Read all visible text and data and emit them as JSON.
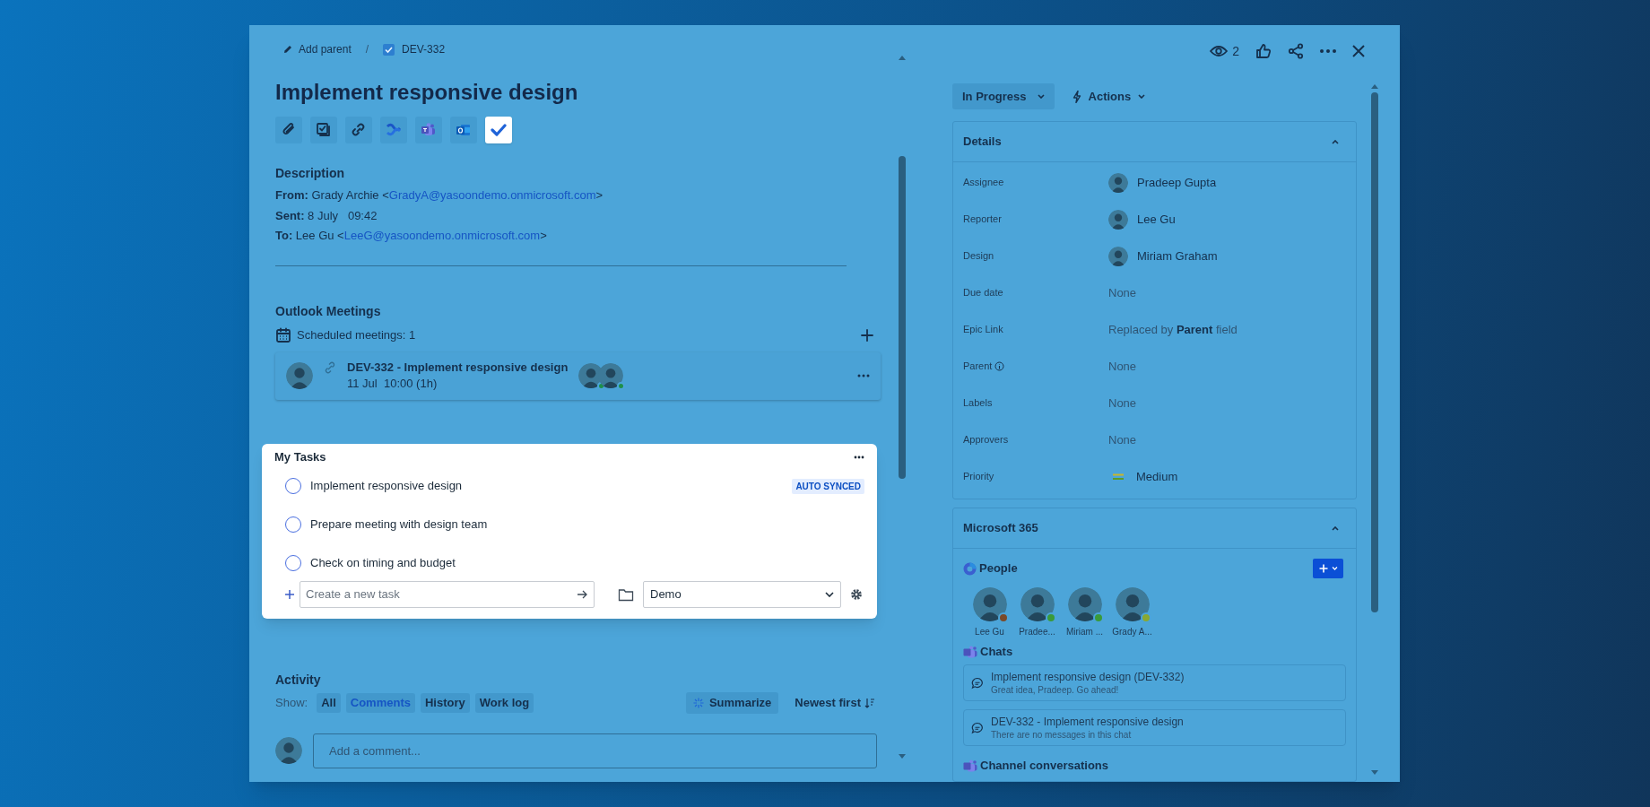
{
  "breadcrumb": {
    "parent": "Add parent",
    "separator": "/",
    "issue": "DEV-332"
  },
  "title": "Implement responsive design",
  "toolbar": [
    {
      "kind": "attach",
      "selected": false
    },
    {
      "kind": "checklist",
      "selected": false
    },
    {
      "kind": "link",
      "selected": false
    },
    {
      "kind": "confluence",
      "selected": false
    },
    {
      "kind": "teams",
      "selected": false
    },
    {
      "kind": "outlook",
      "selected": false
    },
    {
      "kind": "todo",
      "selected": true
    }
  ],
  "description": {
    "heading": "Description",
    "lines": [
      {
        "label": "From:",
        "text": "Grady Archie <",
        "link": "GradyA@yasoondemo.onmicrosoft.com",
        "after": ">"
      },
      {
        "label": "Sent:",
        "text": "8 July   09:42"
      },
      {
        "label": "To:",
        "text": "Lee Gu <",
        "link": "LeeG@yasoondemo.onmicrosoft.com",
        "after": ">"
      }
    ]
  },
  "meetings": {
    "heading": "Outlook Meetings",
    "count": "Scheduled meetings: 1",
    "items": [
      {
        "title": "DEV-332 - Implement responsive design",
        "time": "11 Jul  10:00 (1h)"
      }
    ]
  },
  "tasks": {
    "heading": "My Tasks",
    "items": [
      {
        "text": "Implement responsive design",
        "checked": false,
        "badge": "AUTO SYNCED"
      },
      {
        "text": "Prepare meeting with design team",
        "checked": false
      },
      {
        "text": "Check on timing and budget",
        "checked": false
      }
    ],
    "placeholder": "Create a new task",
    "list": "Demo"
  },
  "activity": {
    "heading": "Activity",
    "show": "Show:",
    "filters": [
      {
        "label": "All",
        "selected": false
      },
      {
        "label": "Comments",
        "selected": true
      },
      {
        "label": "History",
        "selected": false
      },
      {
        "label": "Work log",
        "selected": false
      }
    ],
    "summarize": "Summarize",
    "sort": "Newest first",
    "comment_placeholder": "Add a comment..."
  },
  "header": {
    "watchers": "2"
  },
  "status": "In Progress",
  "actions": "Actions",
  "details": {
    "title": "Details",
    "expanded": true,
    "rows": [
      {
        "label": "Assignee",
        "value": "Pradeep Gupta",
        "kind": "person",
        "info": false
      },
      {
        "label": "Reporter",
        "value": "Lee Gu",
        "kind": "person",
        "info": false
      },
      {
        "label": "Design",
        "value": "Miriam Graham",
        "kind": "person",
        "info": false
      },
      {
        "label": "Due date",
        "value": "None",
        "kind": "empty",
        "info": false
      },
      {
        "label": "Epic Link",
        "value": "Replaced by **Parent** field",
        "kind": "empty",
        "info": false
      },
      {
        "label": "Parent",
        "value": "None",
        "kind": "empty",
        "info": true
      },
      {
        "label": "Labels",
        "value": "None",
        "kind": "empty",
        "info": false
      },
      {
        "label": "Approvers",
        "value": "None",
        "kind": "empty",
        "info": false
      },
      {
        "label": "Priority",
        "value": "Medium",
        "kind": "priority",
        "info": false
      }
    ]
  },
  "m365": {
    "title": "Microsoft 365",
    "expanded": true,
    "people_heading": "People",
    "people": [
      {
        "name": "Lee Gu",
        "color": "#7a4a2a"
      },
      {
        "name": "Pradee...",
        "color": "#3a9a3a"
      },
      {
        "name": "Miriam ...",
        "color": "#3a9a3a"
      },
      {
        "name": "Grady A...",
        "color": "#8aa830"
      }
    ],
    "chats_heading": "Chats",
    "chats": [
      {
        "title": "Implement responsive design (DEV-332)",
        "subtitle": "Great idea, Pradeep. Go ahead!"
      },
      {
        "title": "DEV-332 - Implement responsive design",
        "subtitle": "There are no messages in this chat"
      }
    ],
    "channels_heading": "Channel conversations"
  }
}
